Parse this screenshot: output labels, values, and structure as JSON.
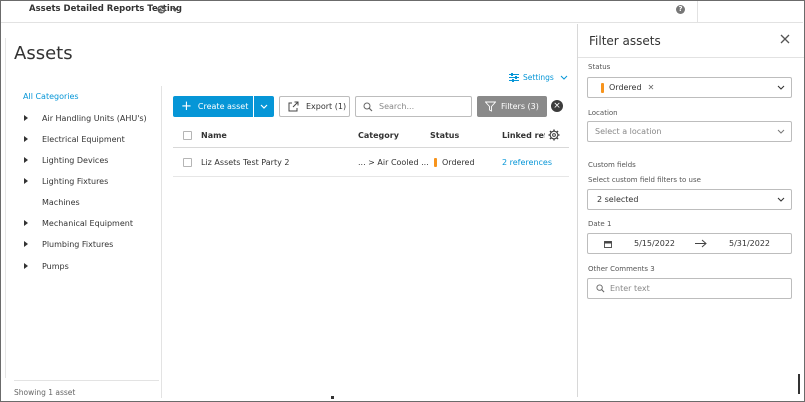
{
  "topbar": {
    "project_name": "Assets Detailed Reports Testing",
    "help_label": "?"
  },
  "page": {
    "title": "Assets",
    "settings_label": "Settings"
  },
  "categories": {
    "all_label": "All Categories",
    "items": [
      {
        "label": "Air Handling Units (AHU's)",
        "expandable": true
      },
      {
        "label": "Electrical Equipment",
        "expandable": true
      },
      {
        "label": "Lighting Devices",
        "expandable": true
      },
      {
        "label": "Lighting Fixtures",
        "expandable": true
      },
      {
        "label": "Machines",
        "expandable": false
      },
      {
        "label": "Mechanical Equipment",
        "expandable": true
      },
      {
        "label": "Plumbing Fixtures",
        "expandable": true
      },
      {
        "label": "Pumps",
        "expandable": true
      }
    ],
    "footer": "Showing 1 asset"
  },
  "toolbar": {
    "create_label": "Create asset",
    "export_label": "Export (1)",
    "search_placeholder": "Search...",
    "filters_label": "Filters (3)"
  },
  "table": {
    "headers": {
      "name": "Name",
      "category": "Category",
      "status": "Status",
      "linked": "Linked refe"
    },
    "rows": [
      {
        "name": "Liz Assets Test Party 2",
        "category": "... > Air Cooled ...",
        "status": "Ordered",
        "linked": "2 references"
      }
    ]
  },
  "filter_panel": {
    "title": "Filter assets",
    "status_label": "Status",
    "status_value": "Ordered",
    "location_label": "Location",
    "location_placeholder": "Select a location",
    "custom_fields_label": "Custom fields",
    "custom_fields_sub": "Select custom field filters to use",
    "custom_fields_value": "2 selected",
    "date_label": "Date 1",
    "date_from": "5/15/2022",
    "date_to": "5/31/2022",
    "comments_label": "Other Comments 3",
    "comments_placeholder": "Enter text"
  },
  "colors": {
    "accent": "#0696d7",
    "status_ordered": "#f7941d",
    "filters_button": "#8a8a8a"
  }
}
